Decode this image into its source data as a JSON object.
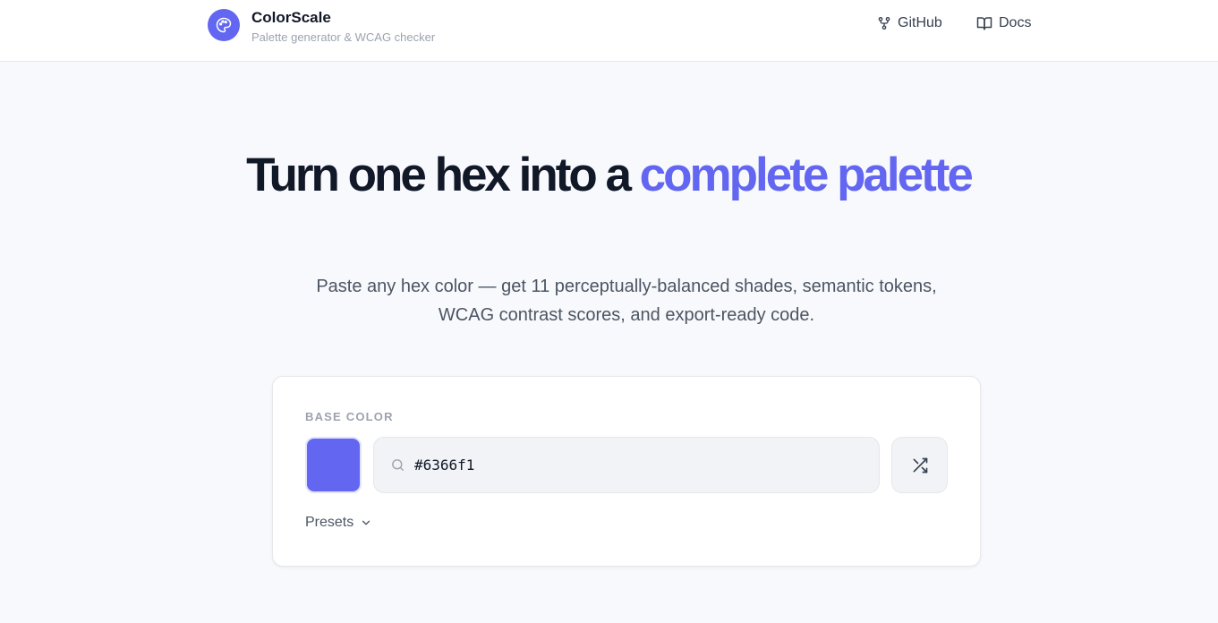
{
  "header": {
    "app_name": "ColorScale",
    "tagline": "Palette generator & WCAG checker",
    "nav": [
      {
        "label": "GitHub",
        "icon": "github-fork-icon"
      },
      {
        "label": "Docs",
        "icon": "book-open-icon"
      }
    ]
  },
  "hero": {
    "title_part1": "Turn one hex into a ",
    "title_accent": "complete palette",
    "subtitle_line1": "Paste any hex color — get 11 perceptually-balanced shades, semantic tokens,",
    "subtitle_line2": "WCAG contrast scores, and export-ready code."
  },
  "base_color": {
    "label": "BASE COLOR",
    "value": "#6366f1",
    "swatch_color": "#6366f1",
    "shuffle_icon": "shuffle-icon",
    "search_icon": "search-icon",
    "presets_label": "Presets"
  },
  "theme": {
    "accent": "#6366f1",
    "background": "#f8f9fc"
  }
}
